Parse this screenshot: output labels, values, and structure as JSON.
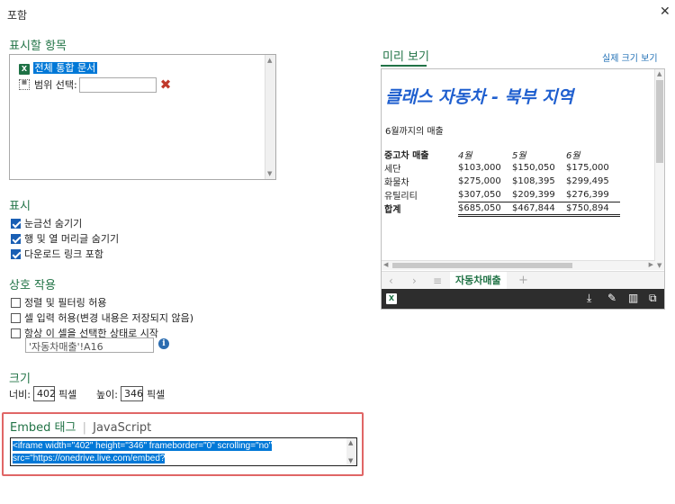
{
  "dialog": {
    "title": "포함",
    "close_glyph": "✕"
  },
  "items_section": {
    "title": "표시할 항목",
    "tree": {
      "entire_workbook": "전체 통합 문서",
      "range_select_label": "범위 선택:",
      "range_value": ""
    }
  },
  "display_section": {
    "title": "표시",
    "options": [
      {
        "label": "눈금선 숨기기",
        "checked": true
      },
      {
        "label": "행 및 열 머리글 숨기기",
        "checked": true
      },
      {
        "label": "다운로드 링크 포함",
        "checked": true
      }
    ]
  },
  "interaction_section": {
    "title": "상호 작용",
    "options": [
      {
        "label": "정렬 및 필터링 허용",
        "checked": false
      },
      {
        "label": "셀 입력 허용(변경 내용은 저장되지 않음)",
        "checked": false
      },
      {
        "label": "항상 이 셀을 선택한 상태로 시작",
        "checked": false
      }
    ],
    "start_cell": "'자동차매출'!A16"
  },
  "size_section": {
    "title": "크기",
    "width_label": "너비:",
    "width_value": "402",
    "width_unit": "픽셀",
    "height_label": "높이:",
    "height_value": "346",
    "height_unit": "픽셀"
  },
  "embed": {
    "tab_embed": "Embed 태그",
    "tab_js": "JavaScript",
    "code_line1": "<iframe width=\"402\" height=\"346\" frameborder=\"0\" scrolling=\"no\"",
    "code_line2": "src=\"https://onedrive.live.com/embed?"
  },
  "preview": {
    "title": "미리 보기",
    "actual_size_link": "실제 크기 보기",
    "sheet": {
      "heading": "클래스 자동차 - 북부 지역",
      "subtitle": "6월까지의 매출",
      "header": [
        "중고차 매출",
        "4월",
        "5월",
        "6월"
      ],
      "rows": [
        [
          "세단",
          "$103,000",
          "$150,050",
          "$175,000"
        ],
        [
          "화물차",
          "$275,000",
          "$108,395",
          "$299,495"
        ],
        [
          "유틸리티",
          "$307,050",
          "$209,399",
          "$276,399"
        ]
      ],
      "total": [
        "합계",
        "$685,050",
        "$467,844",
        "$750,894"
      ]
    },
    "tab_name": "자동차매출",
    "add_tab_glyph": "+"
  },
  "colors": {
    "accent": "#217346",
    "selection": "#0078d7",
    "heading_blue": "#1f5fcf",
    "embed_highlight": "#e06666"
  }
}
